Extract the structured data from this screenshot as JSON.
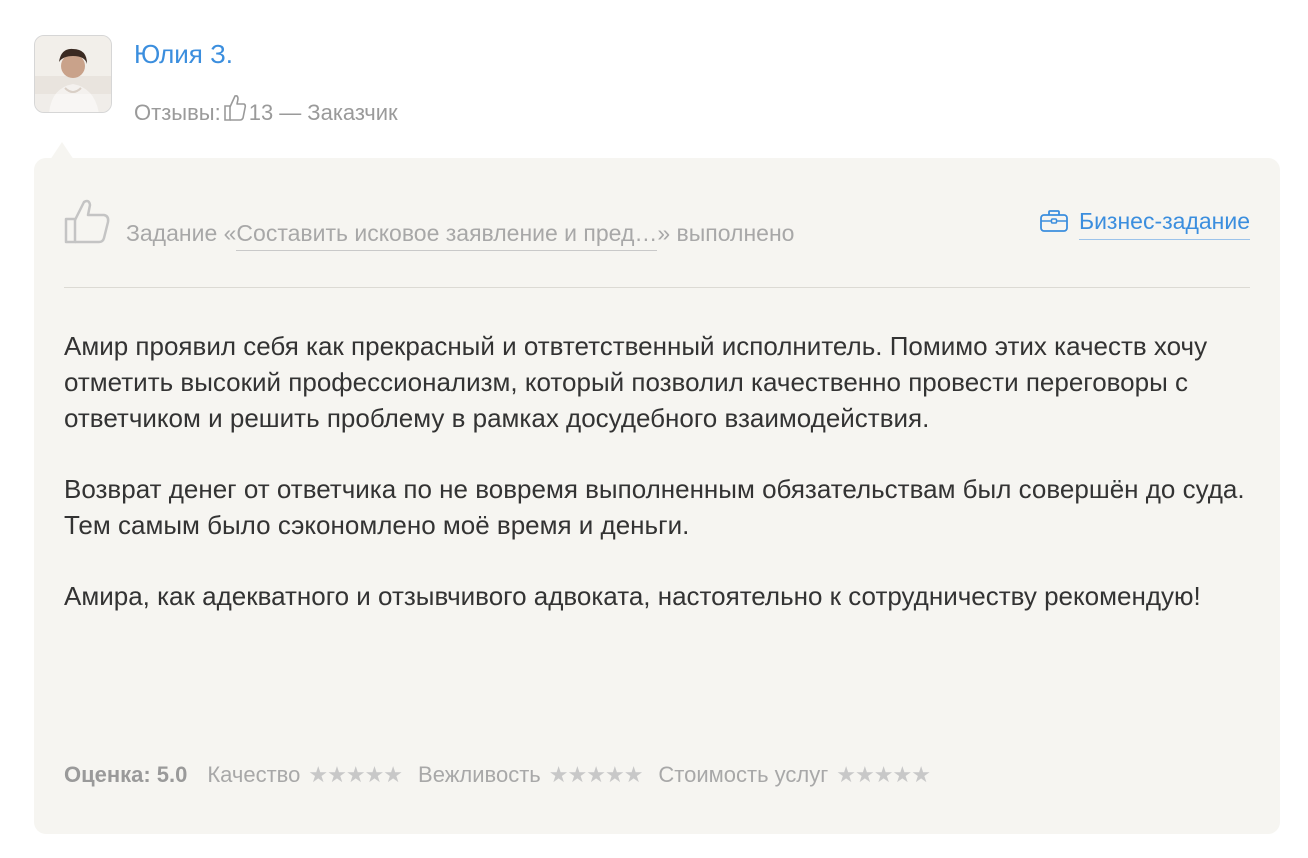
{
  "author": {
    "name": "Юлия З.",
    "reviews_label": "Отзывы:",
    "reviews_count": "13",
    "role": "— Заказчик"
  },
  "task": {
    "prefix": "Задание «",
    "title": "Составить исковое заявление и пред…",
    "suffix": "» выполнено",
    "business_label": "Бизнес-задание"
  },
  "review": {
    "paragraph_1": "Амир проявил себя как прекрасный и отвтетственный исполнитель. Помимо этих качеств хочу отметить высокий профессионализм, который позволил качественно провести переговоры с ответчиком и решить проблему в рамках досудебного взаимодействия.",
    "paragraph_2_line_1": "Возврат денег от ответчика по не вовремя выполненным обязательствам был совершён до суда.",
    "paragraph_2_line_2": "Тем самым было сэкономлено моё время и деньги.",
    "paragraph_3": "Амира, как адекватного и отзывчивого адвоката, настоятельно к сотрудничеству рекомендую!"
  },
  "ratings": {
    "score_label": "Оценка:",
    "score_value": "5.0",
    "items": [
      {
        "label": "Качество",
        "stars": 5
      },
      {
        "label": "Вежливость",
        "stars": 5
      },
      {
        "label": "Стоимость услуг",
        "stars": 5
      }
    ]
  },
  "colors": {
    "link": "#3b8ede",
    "muted": "#a8a8a8",
    "card_bg": "#f6f5f1",
    "body_text": "#333333"
  }
}
